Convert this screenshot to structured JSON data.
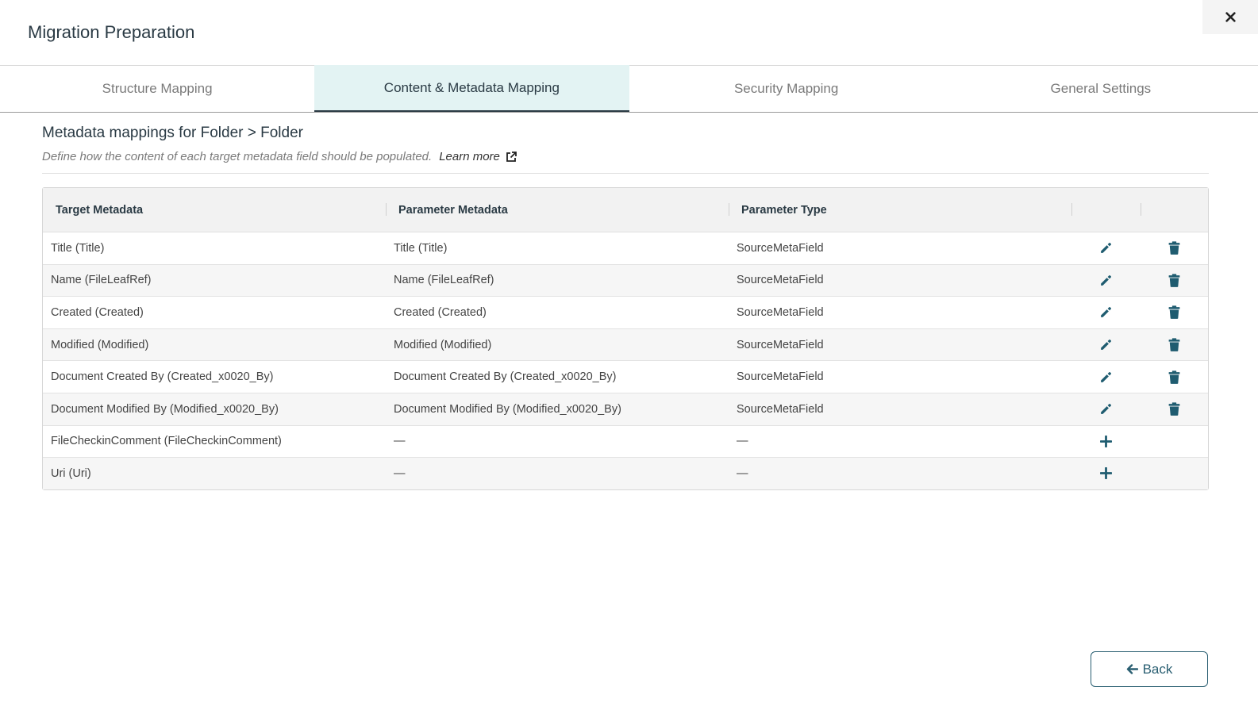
{
  "header": {
    "title": "Migration Preparation",
    "close_label": "×"
  },
  "tabs": [
    {
      "label": "Structure Mapping",
      "active": false
    },
    {
      "label": "Content & Metadata Mapping",
      "active": true
    },
    {
      "label": "Security Mapping",
      "active": false
    },
    {
      "label": "General Settings",
      "active": false
    }
  ],
  "section": {
    "title": "Metadata mappings for Folder > Folder",
    "description": "Define how the content of each target metadata field should be populated.",
    "learn_more": "Learn more"
  },
  "table": {
    "headers": [
      "Target Metadata",
      "Parameter Metadata",
      "Parameter Type",
      "",
      ""
    ],
    "rows": [
      {
        "target": "Title (Title)",
        "parameter": "Title (Title)",
        "type": "SourceMetaField",
        "actions": [
          "edit-icon",
          "delete-icon"
        ]
      },
      {
        "target": "Name (FileLeafRef)",
        "parameter": "Name (FileLeafRef)",
        "type": "SourceMetaField",
        "actions": [
          "edit-icon",
          "delete-icon"
        ]
      },
      {
        "target": "Created (Created)",
        "parameter": "Created (Created)",
        "type": "SourceMetaField",
        "actions": [
          "edit-icon",
          "delete-icon"
        ]
      },
      {
        "target": "Modified (Modified)",
        "parameter": "Modified (Modified)",
        "type": "SourceMetaField",
        "actions": [
          "edit-icon",
          "delete-icon"
        ]
      },
      {
        "target": "Document Created By (Created_x0020_By)",
        "parameter": "Document Created By (Created_x0020_By)",
        "type": "SourceMetaField",
        "actions": [
          "edit-icon",
          "delete-icon"
        ]
      },
      {
        "target": "Document Modified By (Modified_x0020_By)",
        "parameter": "Document Modified By (Modified_x0020_By)",
        "type": "SourceMetaField",
        "actions": [
          "edit-icon",
          "delete-icon"
        ]
      },
      {
        "target": "FileCheckinComment (FileCheckinComment)",
        "parameter": "—",
        "type": "—",
        "actions": [
          "add-icon"
        ]
      },
      {
        "target": "Uri (Uri)",
        "parameter": "—",
        "type": "—",
        "actions": [
          "add-icon"
        ]
      }
    ]
  },
  "footer": {
    "back_label": "Back"
  },
  "colors": {
    "accent": "#2a5f72",
    "active_tab_bg": "#e3f3f3",
    "heading": "#2a3a44"
  }
}
